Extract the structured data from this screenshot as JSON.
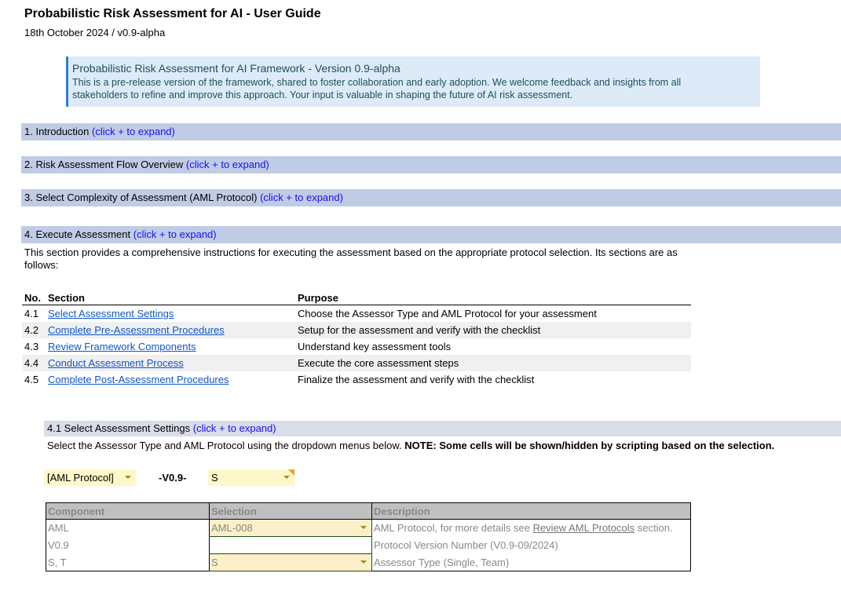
{
  "title": "Probabilistic Risk Assessment for AI - User Guide",
  "subtitle": "18th October 2024 / v0.9-alpha",
  "info": {
    "title": "Probabilistic Risk Assessment for AI Framework - Version 0.9-alpha",
    "body": "This is a pre-release version of the framework, shared to foster collaboration and early adoption. We welcome feedback and insights from all stakeholders to refine and improve this approach. Your input is valuable in shaping the future of AI risk assessment."
  },
  "expand_hint": "(click + to expand)",
  "sections": [
    "1. Introduction",
    "2. Risk Assessment Flow Overview",
    "3. Select Complexity of Assessment (AML Protocol)",
    "4. Execute Assessment"
  ],
  "section4_text": "This section provides a comprehensive instructions for executing the assessment based on the appropriate protocol selection. Its sections are as follows:",
  "toc": {
    "headers": [
      "No.",
      "Section",
      "Purpose"
    ],
    "rows": [
      {
        "no": "4.1",
        "section": "Select Assessment Settings",
        "purpose": "Choose the Assessor Type and AML Protocol for your assessment"
      },
      {
        "no": "4.2",
        "section": "Complete Pre-Assessment Procedures",
        "purpose": "Setup for the assessment and verify with the checklist"
      },
      {
        "no": "4.3",
        "section": "Review Framework Components",
        "purpose": "Understand key assessment tools"
      },
      {
        "no": "4.4",
        "section": "Conduct Assessment Process",
        "purpose": "Execute the core assessment steps"
      },
      {
        "no": "4.5",
        "section": "Complete Post-Assessment Procedures",
        "purpose": "Finalize the assessment and verify with the checklist"
      }
    ]
  },
  "sub41": {
    "title": "4.1 Select Assessment Settings",
    "text": "Select the Assessor Type and AML Protocol using the dropdown menus below.",
    "note": "NOTE: Some cells will be shown/hidden by scripting based on the selection."
  },
  "selectors": {
    "protocol": "[AML Protocol]",
    "version": "-V0.9-",
    "assessor": "S"
  },
  "cmp": {
    "headers": [
      "Component",
      "Selection",
      "Description"
    ],
    "rows": [
      {
        "component": "AML",
        "selection": "AML-008",
        "desc_pre": "AML Protocol, for more details see ",
        "desc_link": "Review AML Protocols",
        "desc_post": " section."
      },
      {
        "component": "V0.9",
        "selection": "",
        "desc_pre": "Protocol Version Number (V0.9-09/2024)"
      },
      {
        "component": "S, T",
        "selection": "S",
        "desc_pre": "Assessor Type (Single, Team)"
      }
    ]
  }
}
